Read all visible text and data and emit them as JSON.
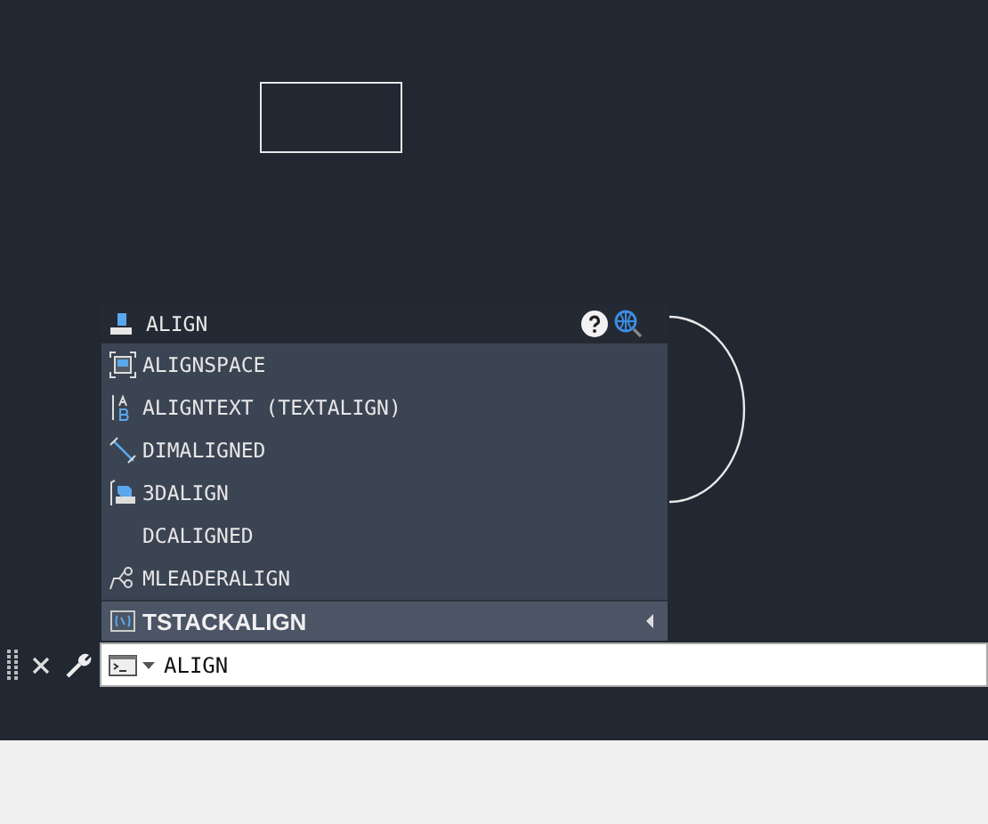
{
  "suggestion_header": {
    "label": "ALIGN"
  },
  "suggestions": [
    {
      "label": "ALIGNSPACE",
      "kind": "space",
      "selected": false
    },
    {
      "label": "ALIGNTEXT (TEXTALIGN)",
      "kind": "text",
      "selected": false
    },
    {
      "label": "DIMALIGNED",
      "kind": "dim",
      "selected": false
    },
    {
      "label": "3DALIGN",
      "kind": "solid",
      "selected": false
    },
    {
      "label": "DCALIGNED",
      "kind": "plain",
      "selected": false
    },
    {
      "label": "MLEADERALIGN",
      "kind": "leader",
      "selected": false
    },
    {
      "label": "TSTACKALIGN",
      "kind": "stack",
      "selected": true
    }
  ],
  "command_line": {
    "value": "ALIGN"
  }
}
